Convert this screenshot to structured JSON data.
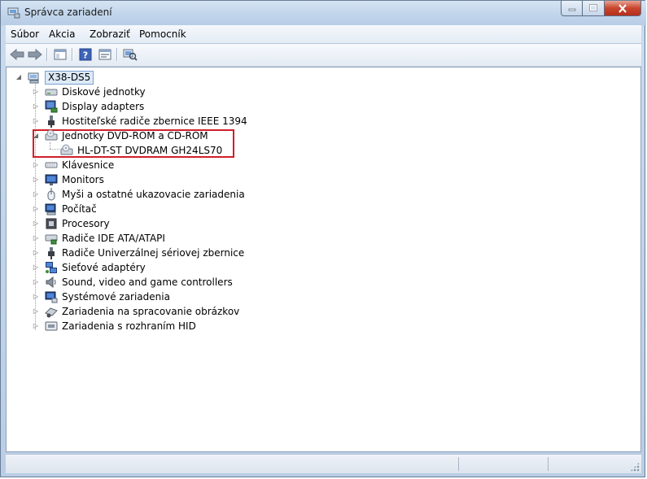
{
  "window": {
    "title": "Správca zariadení",
    "icon": "device-manager-icon",
    "caption_buttons": {
      "minimize": "minimize-icon",
      "maximize": "maximize-icon",
      "close": "close-icon"
    }
  },
  "menu": {
    "items": [
      "Súbor",
      "Akcia",
      "Zobraziť",
      "Pomocník"
    ]
  },
  "toolbar": {
    "buttons": [
      "back-arrow-icon",
      "forward-arrow-icon",
      "show-hide-tree-icon",
      "help-icon",
      "properties-icon",
      "scan-hardware-icon"
    ]
  },
  "tree": {
    "root": {
      "label": "X38-DS5",
      "expanded": true
    },
    "categories": [
      {
        "label": "Diskové jednotky",
        "icon": "disk-drive-icon",
        "expanded": false
      },
      {
        "label": "Display adapters",
        "icon": "display-adapter-icon",
        "expanded": false
      },
      {
        "label": "Hostiteľské radiče zbernice IEEE 1394",
        "icon": "ieee1394-icon",
        "expanded": false
      },
      {
        "label": "Jednotky DVD-ROM a CD-ROM",
        "icon": "dvd-drive-icon",
        "expanded": true,
        "children": [
          {
            "label": "HL-DT-ST DVDRAM GH24LS70",
            "icon": "dvd-drive-icon"
          }
        ]
      },
      {
        "label": "Klávesnice",
        "icon": "keyboard-icon",
        "expanded": false
      },
      {
        "label": "Monitors",
        "icon": "monitor-icon",
        "expanded": false
      },
      {
        "label": "Myši a ostatné ukazovacie zariadenia",
        "icon": "mouse-icon",
        "expanded": false
      },
      {
        "label": "Počítač",
        "icon": "computer-icon",
        "expanded": false
      },
      {
        "label": "Procesory",
        "icon": "processor-icon",
        "expanded": false
      },
      {
        "label": "Radiče IDE ATA/ATAPI",
        "icon": "ide-controller-icon",
        "expanded": false
      },
      {
        "label": "Radiče Univerzálnej sériovej zbernice",
        "icon": "usb-icon",
        "expanded": false
      },
      {
        "label": "Sieťové adaptéry",
        "icon": "network-adapter-icon",
        "expanded": false
      },
      {
        "label": "Sound, video and game controllers",
        "icon": "sound-icon",
        "expanded": false
      },
      {
        "label": "Systémové zariadenia",
        "icon": "system-device-icon",
        "expanded": false
      },
      {
        "label": "Zariadenia na spracovanie obrázkov",
        "icon": "imaging-device-icon",
        "expanded": false
      },
      {
        "label": "Zariadenia s rozhraním HID",
        "icon": "hid-icon",
        "expanded": false
      }
    ]
  },
  "highlight_color": "#d0202a"
}
